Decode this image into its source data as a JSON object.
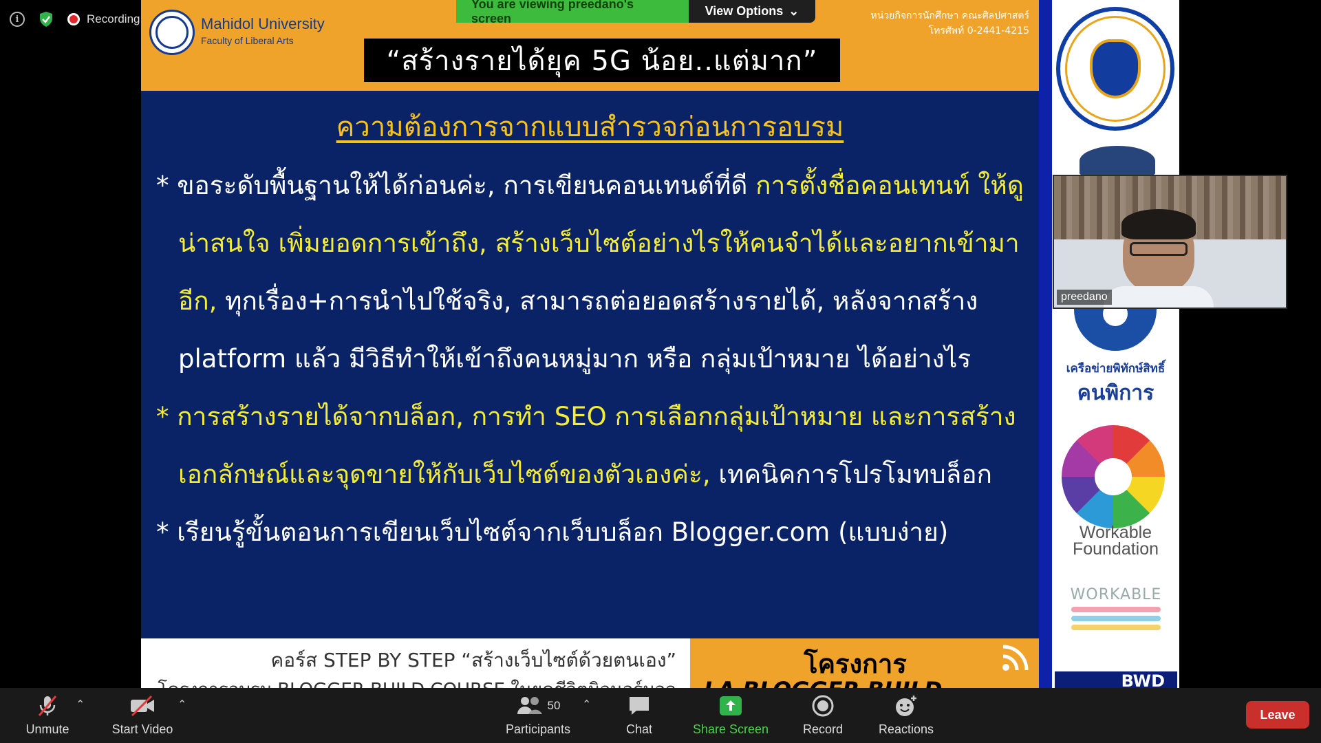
{
  "status": {
    "recording_label": "Recording"
  },
  "banner": {
    "viewing_text": "You are viewing preedano's screen",
    "view_options_label": "View Options"
  },
  "slide": {
    "university_name": "Mahidol University",
    "faculty": "Faculty of Liberal Arts",
    "contact_line1": "หน่วยกิจการนักศึกษา คณะศิลปศาสตร์",
    "contact_line2": "โทรศัพท์ 0-2441-4215",
    "title": "“สร้างรายได้ยุค 5G น้อย..แต่มาก”",
    "heading": "ความต้องการจากแบบสำรวจก่อนการอบรม",
    "bullet1_part1": "* ขอระดับพื้นฐานให้ได้ก่อนค่ะ, การเขียนคอนเทนต์ที่ดี ",
    "bullet1_part2": "การตั้งชื่อคอนเทนท์ ให้ดูน่าสนใจ เพิ่มยอดการเข้าถึง, สร้างเว็บไซต์อย่างไรให้คนจำได้และอยากเข้ามาอีก,",
    "bullet1_part3": " ทุกเรื่อง+การนำไปใช้จริง, สามารถต่อยอดสร้างรายได้, หลังจากสร้าง platform แล้ว มีวิธีทำให้เข้าถึงคนหมู่มาก หรือ กลุ่มเป้าหมาย ได้อย่างไร",
    "bullet2_part1": "* การสร้างรายได้จากบล็อก, การทำ SEO การเลือกกลุ่มเป้าหมาย และการสร้างเอกลักษณ์และจุดขายให้กับเว็บไซต์ของตัวเองค่ะ,",
    "bullet2_part2": " เทคนิคการโปรโมทบล็อก",
    "bullet3": "* เรียนรู้ขั้นตอนการเขียนเว็บไซต์จากเว็บบล็อก Blogger.com (แบบง่าย)",
    "footer_course": "คอร์ส STEP BY STEP “สร้างเว็บไซต์ด้วยตนเอง”",
    "footer_course_sub": "โครงการอบรม BLOGGER BUILD COURSE ในยุคชีวิตนิวนอร์มอล",
    "footer_project": "โครงการ",
    "footer_project_sub": "LA BLOGGER BUILD COURSE"
  },
  "partners": {
    "network_line1": "เครือข่ายพิทักษ์สิทธิ์",
    "network_line2": "คนพิการ",
    "workable_line1": "Workable",
    "workable_line2": "Foundation",
    "workable_small": "WORKABLE",
    "bwd": "BWD"
  },
  "video": {
    "participant_name": "preedano"
  },
  "toolbar": {
    "unmute_label": "Unmute",
    "start_video_label": "Start Video",
    "participants_label": "Participants",
    "participants_count": "50",
    "chat_label": "Chat",
    "share_screen_label": "Share Screen",
    "record_label": "Record",
    "reactions_label": "Reactions",
    "leave_label": "Leave"
  },
  "colors": {
    "slide_bg": "#0a2366",
    "header_orange": "#f0a32a",
    "highlight_yellow": "#f5ec36",
    "share_green": "#4bd04b",
    "leave_red": "#c9302c"
  }
}
